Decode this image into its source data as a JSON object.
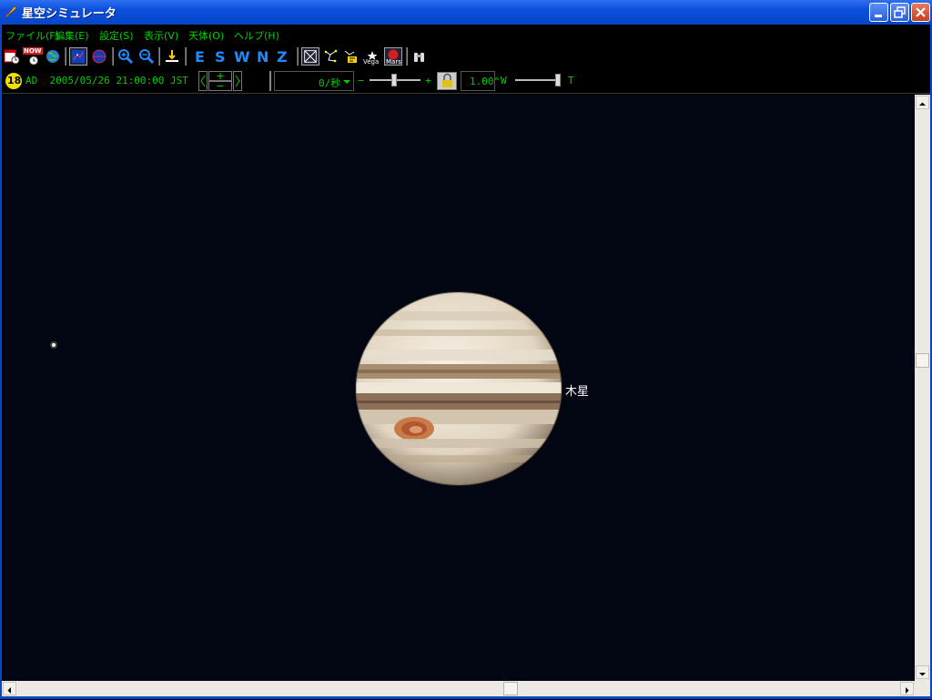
{
  "window": {
    "title": "星空シミュレータ"
  },
  "menu": [
    {
      "label": "ファイル(F)"
    },
    {
      "label": "編集(E)"
    },
    {
      "label": "設定(S)"
    },
    {
      "label": "表示(V)"
    },
    {
      "label": "天体(O)"
    },
    {
      "label": "ヘルプ(H)"
    }
  ],
  "toolbar": {
    "directions": [
      "E",
      "S",
      "W",
      "N",
      "Z"
    ],
    "now_label": "NOW",
    "vega_label": "Vega",
    "mars_label": "Mars"
  },
  "timebar": {
    "moon_age": "18",
    "datetime": "AD  2005/05/26 21:00:00 JST",
    "rate": "0/秒",
    "minus": "−",
    "plus": "+",
    "fov": "1.00°",
    "wide": "W",
    "tele": "T"
  },
  "sky": {
    "planet_label": "木星"
  },
  "scroll": {
    "vertical_position": 0.45,
    "horizontal_position": 0.56
  }
}
